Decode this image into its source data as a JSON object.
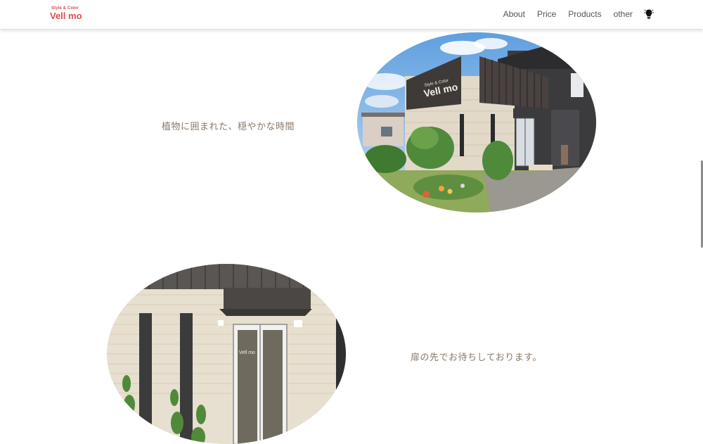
{
  "header": {
    "logo_tagline": "Style & Color",
    "logo_name": "Vell mo",
    "nav": [
      "About",
      "Price",
      "Products",
      "other"
    ],
    "theme_icon": "lightbulb-icon"
  },
  "sections": [
    {
      "text": "植物に囲まれた、穏やかな時間",
      "photo_sign_small": "Style & Color",
      "photo_sign": "Vell mo"
    },
    {
      "text": "扉の先でお待ちしております。",
      "photo_sign": "Vell mo"
    }
  ],
  "colors": {
    "brand": "#e04a4a",
    "text": "#8a7a6a",
    "nav": "#555555"
  }
}
